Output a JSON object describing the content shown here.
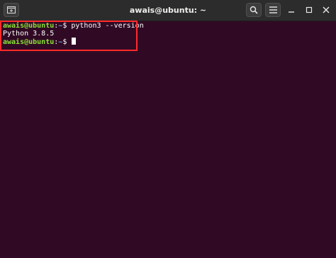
{
  "window": {
    "title": "awais@ubuntu: ~",
    "colors": {
      "background": "#300a24",
      "titlebar": "#2c2c2c",
      "prompt_user": "#8ae234",
      "prompt_path": "#729fcf",
      "highlight_border": "#ff2a2a"
    },
    "icons": {
      "new_tab": "new-tab-icon",
      "search": "search-icon",
      "menu": "hamburger-menu-icon",
      "minimize": "minimize-icon",
      "maximize": "maximize-icon",
      "close": "close-icon"
    }
  },
  "terminal": {
    "lines": [
      {
        "user_host": "awais@ubuntu",
        "colon": ":",
        "path": "~",
        "symbol": "$ ",
        "command": "python3 --version"
      },
      {
        "output": "Python 3.8.5"
      },
      {
        "user_host": "awais@ubuntu",
        "colon": ":",
        "path": "~",
        "symbol": "$ ",
        "command": ""
      }
    ]
  }
}
